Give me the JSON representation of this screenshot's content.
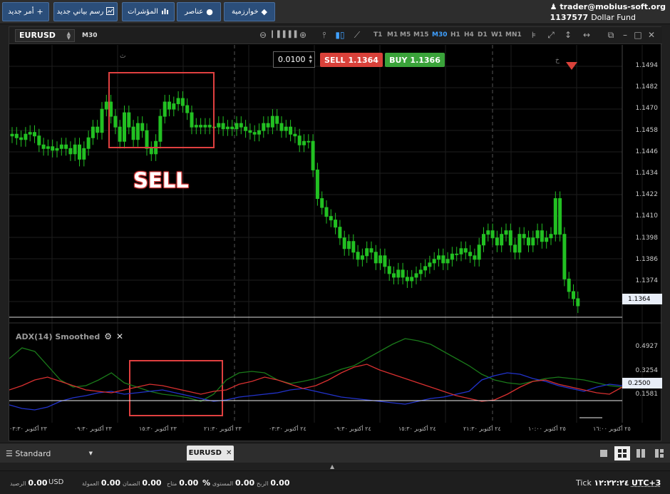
{
  "toolbar": {
    "new_order": "أمر جديد",
    "new_chart": "رسم بياني جديد",
    "indicators": "المؤشرات",
    "elements": "عناصر",
    "algorithms": "خوارزمية"
  },
  "account": {
    "user": "trader@mobius-soft.org",
    "number": "1137577",
    "fund": "Dollar Fund"
  },
  "chart": {
    "symbol": "EURUSD",
    "timeframe": "M30",
    "timeframes": [
      "T1",
      "M1",
      "M5",
      "M15",
      "M30",
      "H1",
      "H4",
      "D1",
      "W1",
      "MN1"
    ],
    "active_timeframe": "M30",
    "lot": "0.0100",
    "sell_label": "SELL",
    "sell_price": "1.1364",
    "buy_label": "BUY",
    "buy_price": "1.1366",
    "annotation": "SELL",
    "price_scale": [
      "1.1494",
      "1.1482",
      "1.1470",
      "1.1458",
      "1.1446",
      "1.1434",
      "1.1422",
      "1.1410",
      "1.1398",
      "1.1386",
      "1.1374"
    ],
    "current_price": "1.1364",
    "session_marks": [
      "ث",
      "خ"
    ],
    "indicator_title": "ADX(14) Smoothed",
    "indicator_scale": [
      "0.4927",
      "0.3254",
      "0.1581"
    ],
    "indicator_level": "0.2500",
    "time_labels": [
      "٢٣ أكتوبر ٠٣:٣٠",
      "٢٣ أكتوبر ٠٩:٣٠",
      "٢٣ أكتوبر ١٥:٣٠",
      "٢٣ أكتوبر ٢١:٣٠",
      "٢٤ أكتوبر ٠٣:٣٠",
      "٢٤ أكتوبر ٠٩:٣٠",
      "٢٤ أكتوبر ١٥:٣٠",
      "٢٤ أكتوبر ٢١:٣٠",
      "٢٥ أكتوبر ١٠:٠٠",
      "٢٥ أكتوبر ١٦:٠٠"
    ],
    "colors": {
      "bull": "#22c022",
      "bear": "#22c022",
      "adx": "#1a7a1a",
      "plus_di": "#2233cc",
      "minus_di": "#d93030",
      "highlight": "#e04040"
    }
  },
  "tabs": {
    "layout": "Standard",
    "open_tab": "EURUSD"
  },
  "status": {
    "balance_label": "الرصيد",
    "balance_value": "0.00",
    "currency": "USD",
    "commission_label": "العمولة",
    "commission_value": "0.00",
    "margin_label": "الضمان",
    "margin_value": "0.00",
    "free_label": "متاح",
    "free_value": "0.00",
    "level_label": "المستوى",
    "level_value": "0.00",
    "level_unit": "%",
    "profit_label": "الربح",
    "profit_value": "0.00",
    "tick_label": "Tick",
    "time": "١٢:٢٢:٢٤",
    "timezone": "UTC+3"
  }
}
